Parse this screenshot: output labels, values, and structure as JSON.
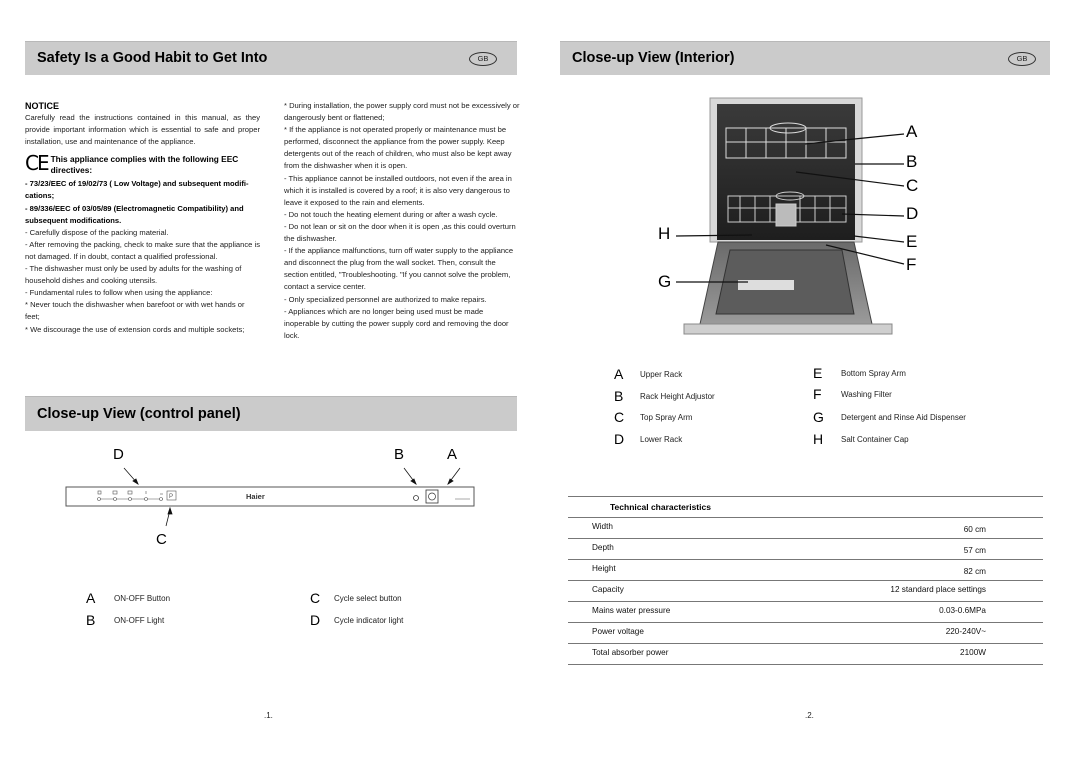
{
  "page1": {
    "header": {
      "title": "Safety Is a Good Habit to Get Into",
      "badge": "GB"
    },
    "left_column": {
      "notice_title": "NOTICE",
      "notice_text": "Carefully read the instructions contained in this manual, as they provide important information which is essential to safe and proper installation, use and maintenance of the appliance.",
      "ce_mark": "CE",
      "ce_text": "This appliance complies with the following EEC directives:",
      "directive_1": "- 73/23/EEC of 19/02/73 ( Low Voltage) and subsequent modifi- cations;",
      "directive_2": "- 89/336/EEC of 03/05/89 (Electromagnetic Compatibility) and subsequent modifications.",
      "items": [
        "- Carefully dispose of the packing material.",
        "- After removing the packing, check to make sure that the appliance is not damaged. If in doubt, contact a qualified professional.",
        "- The dishwasher must only be used by adults for the washing of household dishes and cooking utensils.",
        "- Fundamental rules to follow when using the appliance:",
        "* Never touch the dishwasher when barefoot or with wet hands or feet;",
        "* We discourage the use of extension cords and multiple sockets;"
      ]
    },
    "right_column": {
      "items": [
        "* During installation, the power supply cord must not be excessively or dangerously bent or flattened;",
        "* If the appliance is not operated properly or maintenance must be performed, disconnect the appliance from the power supply. Keep detergents out of the reach of children, who must also be kept away from the dishwasher when it is open.",
        "- This appliance cannot be installed outdoors, not even if the area in which it is installed is covered by a roof; it is also very dangerous to leave it exposed to the rain and elements.",
        "- Do not touch the heating element during or after a wash cycle.",
        "- Do not lean or sit on the door when it is open ,as this could overturn the dishwasher.",
        "- If the appliance malfunctions, turn off water supply to the appliance and disconnect the plug from the wall socket. Then, consult the section entitled, \"Troubleshooting. \"If you cannot solve the problem, contact a service center.",
        "- Only specialized personnel are authorized to make repairs.",
        "- Appliances which are no longer being used must be made inoperable by cutting the power supply cord and removing the door lock."
      ]
    },
    "control_panel": {
      "title": "Close-up View (control panel)",
      "brand": "Haier",
      "callouts": {
        "a": "A",
        "b": "B",
        "c": "C",
        "d": "D"
      },
      "legend": [
        {
          "letter": "A",
          "label": "ON-OFF Button"
        },
        {
          "letter": "B",
          "label": "ON-OFF Light"
        },
        {
          "letter": "C",
          "label": "Cycle select button"
        },
        {
          "letter": "D",
          "label": "Cycle indicator light"
        }
      ]
    },
    "page_number": ".1."
  },
  "page2": {
    "header": {
      "title": "Close-up View (Interior)",
      "badge": "GB"
    },
    "callouts": [
      "A",
      "B",
      "C",
      "D",
      "E",
      "F",
      "G",
      "H"
    ],
    "legend": [
      {
        "letter": "A",
        "label": "Upper Rack"
      },
      {
        "letter": "B",
        "label": "Rack Height Adjustor"
      },
      {
        "letter": "C",
        "label": "Top Spray Arm"
      },
      {
        "letter": "D",
        "label": "Lower Rack"
      },
      {
        "letter": "E",
        "label": "Bottom Spray Arm"
      },
      {
        "letter": "F",
        "label": "Washing Filter"
      },
      {
        "letter": "G",
        "label": "Detergent and Rinse Aid Dispenser"
      },
      {
        "letter": "H",
        "label": "Salt Container Cap"
      }
    ],
    "technical": {
      "title": "Technical characteristics",
      "rows": [
        {
          "key": "Width",
          "value": "60 cm"
        },
        {
          "key": "Depth",
          "value": "57 cm"
        },
        {
          "key": "Height",
          "value": "82 cm"
        },
        {
          "key": "Capacity",
          "value": "12 standard place settings"
        },
        {
          "key": "Mains water pressure",
          "value": "0.03-0.6MPa"
        },
        {
          "key": "Power voltage",
          "value": "220-240V~"
        },
        {
          "key": "Total absorber power",
          "value": "2100W"
        }
      ]
    },
    "page_number": ".2."
  }
}
